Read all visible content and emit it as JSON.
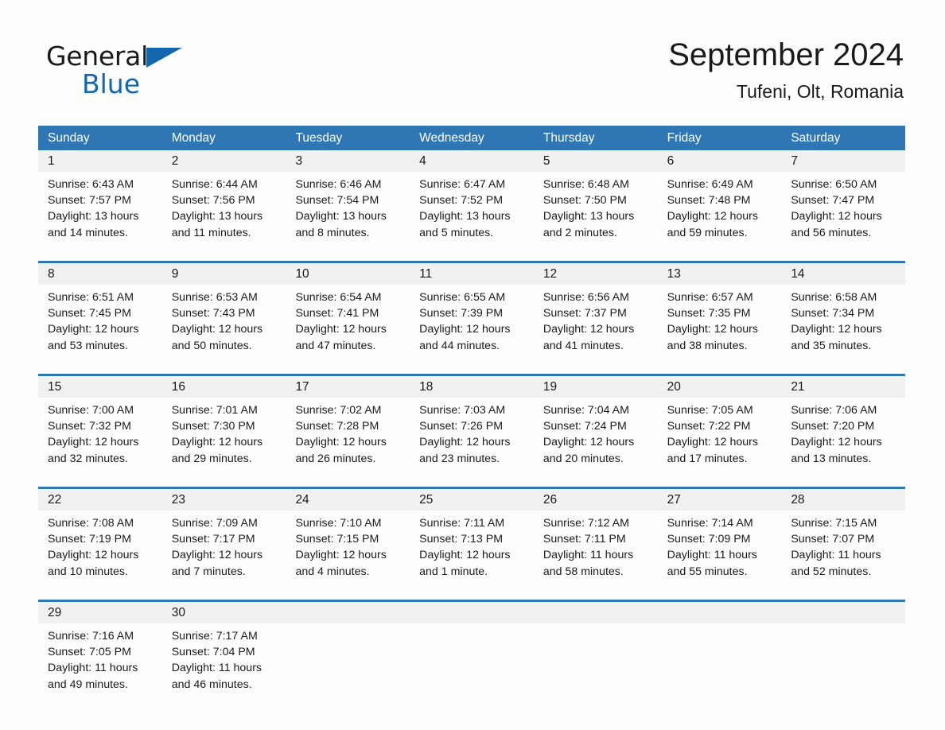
{
  "brand": {
    "name_part1": "General",
    "name_part2": "Blue",
    "accent_color": "#1267ad"
  },
  "header": {
    "title": "September 2024",
    "subtitle": "Tufeni, Olt, Romania",
    "header_bg_color": "#2f76b4",
    "daynum_bg_color": "#f1f1f1"
  },
  "weekday_headers": [
    "Sunday",
    "Monday",
    "Tuesday",
    "Wednesday",
    "Thursday",
    "Friday",
    "Saturday"
  ],
  "labels": {
    "sunrise_prefix": "Sunrise:",
    "sunset_prefix": "Sunset:",
    "daylight_prefix": "Daylight:"
  },
  "weeks": [
    {
      "days": [
        {
          "num": "1",
          "sunrise": "Sunrise: 6:43 AM",
          "sunset": "Sunset: 7:57 PM",
          "daylight1": "Daylight: 13 hours",
          "daylight2": "and 14 minutes."
        },
        {
          "num": "2",
          "sunrise": "Sunrise: 6:44 AM",
          "sunset": "Sunset: 7:56 PM",
          "daylight1": "Daylight: 13 hours",
          "daylight2": "and 11 minutes."
        },
        {
          "num": "3",
          "sunrise": "Sunrise: 6:46 AM",
          "sunset": "Sunset: 7:54 PM",
          "daylight1": "Daylight: 13 hours",
          "daylight2": "and 8 minutes."
        },
        {
          "num": "4",
          "sunrise": "Sunrise: 6:47 AM",
          "sunset": "Sunset: 7:52 PM",
          "daylight1": "Daylight: 13 hours",
          "daylight2": "and 5 minutes."
        },
        {
          "num": "5",
          "sunrise": "Sunrise: 6:48 AM",
          "sunset": "Sunset: 7:50 PM",
          "daylight1": "Daylight: 13 hours",
          "daylight2": "and 2 minutes."
        },
        {
          "num": "6",
          "sunrise": "Sunrise: 6:49 AM",
          "sunset": "Sunset: 7:48 PM",
          "daylight1": "Daylight: 12 hours",
          "daylight2": "and 59 minutes."
        },
        {
          "num": "7",
          "sunrise": "Sunrise: 6:50 AM",
          "sunset": "Sunset: 7:47 PM",
          "daylight1": "Daylight: 12 hours",
          "daylight2": "and 56 minutes."
        }
      ]
    },
    {
      "days": [
        {
          "num": "8",
          "sunrise": "Sunrise: 6:51 AM",
          "sunset": "Sunset: 7:45 PM",
          "daylight1": "Daylight: 12 hours",
          "daylight2": "and 53 minutes."
        },
        {
          "num": "9",
          "sunrise": "Sunrise: 6:53 AM",
          "sunset": "Sunset: 7:43 PM",
          "daylight1": "Daylight: 12 hours",
          "daylight2": "and 50 minutes."
        },
        {
          "num": "10",
          "sunrise": "Sunrise: 6:54 AM",
          "sunset": "Sunset: 7:41 PM",
          "daylight1": "Daylight: 12 hours",
          "daylight2": "and 47 minutes."
        },
        {
          "num": "11",
          "sunrise": "Sunrise: 6:55 AM",
          "sunset": "Sunset: 7:39 PM",
          "daylight1": "Daylight: 12 hours",
          "daylight2": "and 44 minutes."
        },
        {
          "num": "12",
          "sunrise": "Sunrise: 6:56 AM",
          "sunset": "Sunset: 7:37 PM",
          "daylight1": "Daylight: 12 hours",
          "daylight2": "and 41 minutes."
        },
        {
          "num": "13",
          "sunrise": "Sunrise: 6:57 AM",
          "sunset": "Sunset: 7:35 PM",
          "daylight1": "Daylight: 12 hours",
          "daylight2": "and 38 minutes."
        },
        {
          "num": "14",
          "sunrise": "Sunrise: 6:58 AM",
          "sunset": "Sunset: 7:34 PM",
          "daylight1": "Daylight: 12 hours",
          "daylight2": "and 35 minutes."
        }
      ]
    },
    {
      "days": [
        {
          "num": "15",
          "sunrise": "Sunrise: 7:00 AM",
          "sunset": "Sunset: 7:32 PM",
          "daylight1": "Daylight: 12 hours",
          "daylight2": "and 32 minutes."
        },
        {
          "num": "16",
          "sunrise": "Sunrise: 7:01 AM",
          "sunset": "Sunset: 7:30 PM",
          "daylight1": "Daylight: 12 hours",
          "daylight2": "and 29 minutes."
        },
        {
          "num": "17",
          "sunrise": "Sunrise: 7:02 AM",
          "sunset": "Sunset: 7:28 PM",
          "daylight1": "Daylight: 12 hours",
          "daylight2": "and 26 minutes."
        },
        {
          "num": "18",
          "sunrise": "Sunrise: 7:03 AM",
          "sunset": "Sunset: 7:26 PM",
          "daylight1": "Daylight: 12 hours",
          "daylight2": "and 23 minutes."
        },
        {
          "num": "19",
          "sunrise": "Sunrise: 7:04 AM",
          "sunset": "Sunset: 7:24 PM",
          "daylight1": "Daylight: 12 hours",
          "daylight2": "and 20 minutes."
        },
        {
          "num": "20",
          "sunrise": "Sunrise: 7:05 AM",
          "sunset": "Sunset: 7:22 PM",
          "daylight1": "Daylight: 12 hours",
          "daylight2": "and 17 minutes."
        },
        {
          "num": "21",
          "sunrise": "Sunrise: 7:06 AM",
          "sunset": "Sunset: 7:20 PM",
          "daylight1": "Daylight: 12 hours",
          "daylight2": "and 13 minutes."
        }
      ]
    },
    {
      "days": [
        {
          "num": "22",
          "sunrise": "Sunrise: 7:08 AM",
          "sunset": "Sunset: 7:19 PM",
          "daylight1": "Daylight: 12 hours",
          "daylight2": "and 10 minutes."
        },
        {
          "num": "23",
          "sunrise": "Sunrise: 7:09 AM",
          "sunset": "Sunset: 7:17 PM",
          "daylight1": "Daylight: 12 hours",
          "daylight2": "and 7 minutes."
        },
        {
          "num": "24",
          "sunrise": "Sunrise: 7:10 AM",
          "sunset": "Sunset: 7:15 PM",
          "daylight1": "Daylight: 12 hours",
          "daylight2": "and 4 minutes."
        },
        {
          "num": "25",
          "sunrise": "Sunrise: 7:11 AM",
          "sunset": "Sunset: 7:13 PM",
          "daylight1": "Daylight: 12 hours",
          "daylight2": "and 1 minute."
        },
        {
          "num": "26",
          "sunrise": "Sunrise: 7:12 AM",
          "sunset": "Sunset: 7:11 PM",
          "daylight1": "Daylight: 11 hours",
          "daylight2": "and 58 minutes."
        },
        {
          "num": "27",
          "sunrise": "Sunrise: 7:14 AM",
          "sunset": "Sunset: 7:09 PM",
          "daylight1": "Daylight: 11 hours",
          "daylight2": "and 55 minutes."
        },
        {
          "num": "28",
          "sunrise": "Sunrise: 7:15 AM",
          "sunset": "Sunset: 7:07 PM",
          "daylight1": "Daylight: 11 hours",
          "daylight2": "and 52 minutes."
        }
      ]
    },
    {
      "days": [
        {
          "num": "29",
          "sunrise": "Sunrise: 7:16 AM",
          "sunset": "Sunset: 7:05 PM",
          "daylight1": "Daylight: 11 hours",
          "daylight2": "and 49 minutes."
        },
        {
          "num": "30",
          "sunrise": "Sunrise: 7:17 AM",
          "sunset": "Sunset: 7:04 PM",
          "daylight1": "Daylight: 11 hours",
          "daylight2": "and 46 minutes."
        },
        {
          "num": "",
          "sunrise": "",
          "sunset": "",
          "daylight1": "",
          "daylight2": ""
        },
        {
          "num": "",
          "sunrise": "",
          "sunset": "",
          "daylight1": "",
          "daylight2": ""
        },
        {
          "num": "",
          "sunrise": "",
          "sunset": "",
          "daylight1": "",
          "daylight2": ""
        },
        {
          "num": "",
          "sunrise": "",
          "sunset": "",
          "daylight1": "",
          "daylight2": ""
        },
        {
          "num": "",
          "sunrise": "",
          "sunset": "",
          "daylight1": "",
          "daylight2": ""
        }
      ]
    }
  ]
}
